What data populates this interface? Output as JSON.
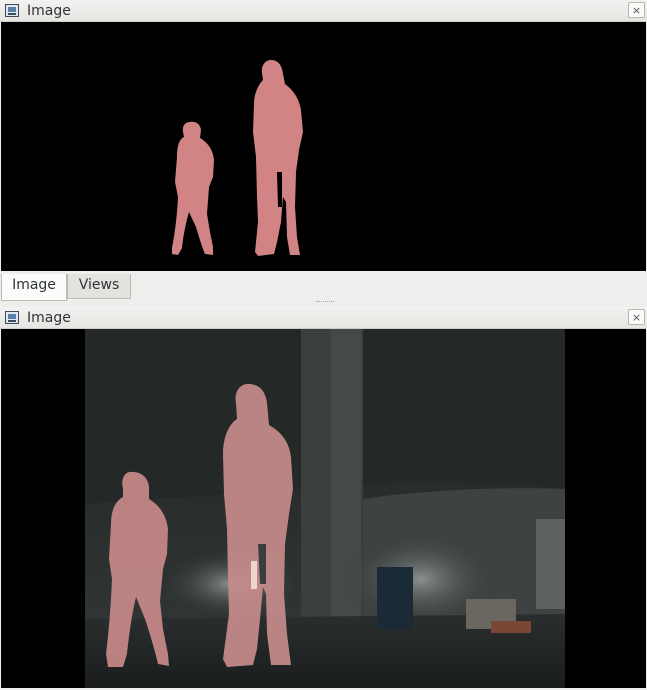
{
  "panels": [
    {
      "title": "Image",
      "close_label": "×"
    },
    {
      "title": "Image",
      "close_label": "×"
    }
  ],
  "tabs": [
    {
      "label": "Image",
      "active": true
    },
    {
      "label": "Views",
      "active": false
    }
  ],
  "colors": {
    "mask": "#d98383",
    "background": "#000000"
  }
}
